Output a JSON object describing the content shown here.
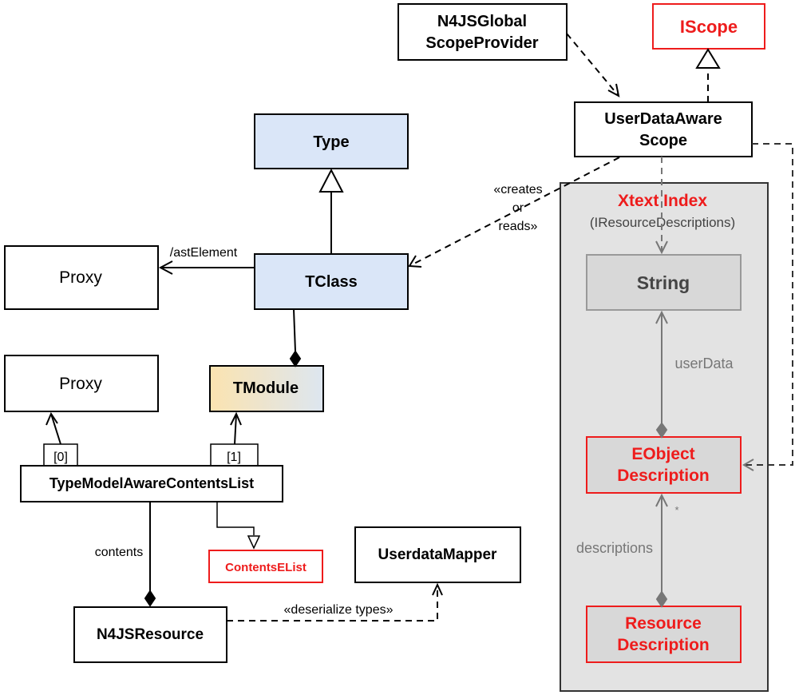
{
  "colors": {
    "class_fill": "#dae6f8",
    "index_fill": "#e3e3e3",
    "accent_red": "#ee1c1c",
    "gray": "#777777"
  },
  "classes": {
    "global_provider": [
      "N4JSGlobal",
      "ScopeProvider"
    ],
    "iscope": "IScope",
    "user_data_aware_scope": [
      "UserDataAware",
      "Scope"
    ],
    "type": "Type",
    "tclass": "TClass",
    "proxy_ast": "Proxy",
    "proxy_list": "Proxy",
    "tmodule": "TModule",
    "contents_list": "TypeModelAwareContentsList",
    "index0": "[0]",
    "index1": "[1]",
    "contents_elist": "ContentsEList",
    "userdata_mapper": "UserdataMapper",
    "n4js_resource": "N4JSResource"
  },
  "index": {
    "title": "Xtext Index",
    "subtitle": "(IResourceDescriptions)",
    "string": "String",
    "eobject_description": [
      "EObject",
      "Description"
    ],
    "resource_description": [
      "Resource",
      "Description"
    ]
  },
  "labels": {
    "ast_element": "/astElement",
    "creates_or_reads": [
      "«creates",
      "or",
      "reads»"
    ],
    "contents": "contents",
    "deserialize": "«deserialize types»",
    "user_data": "userData",
    "descriptions": "descriptions",
    "multiplicity": "*"
  }
}
